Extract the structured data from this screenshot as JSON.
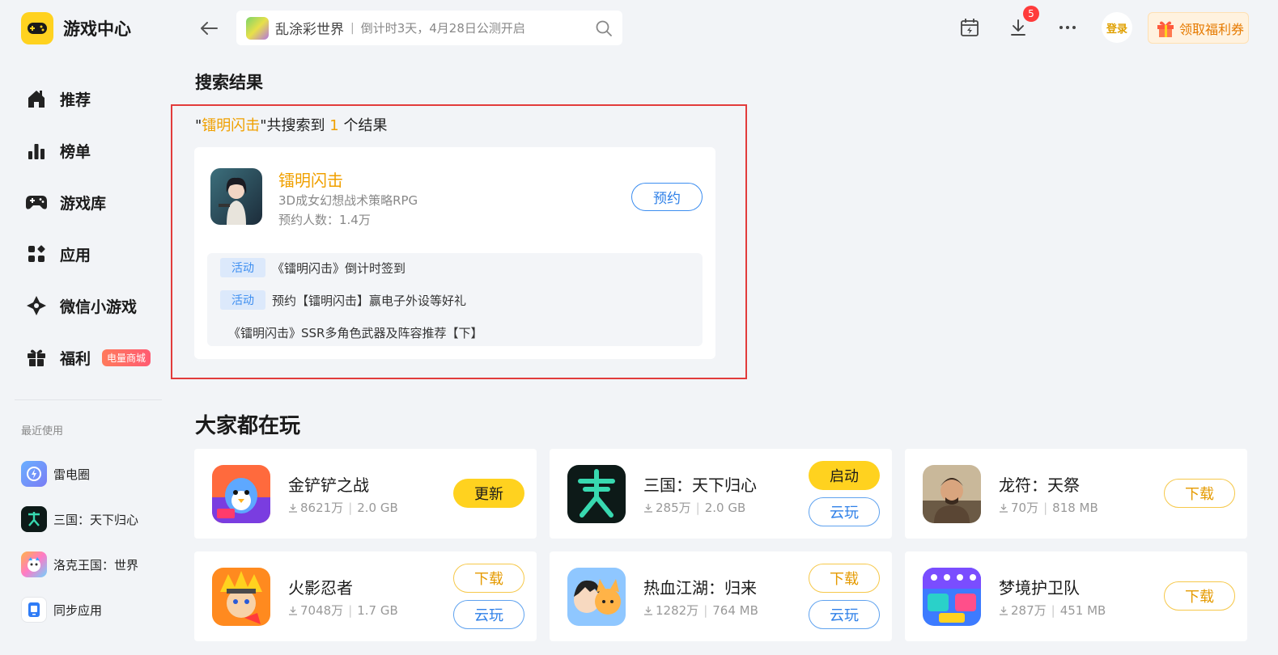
{
  "app": {
    "title": "游戏中心"
  },
  "sidebar": {
    "items": [
      {
        "label": "推荐",
        "icon": "home-icon"
      },
      {
        "label": "榜单",
        "icon": "ranking-icon"
      },
      {
        "label": "游戏库",
        "icon": "gamepad-icon"
      },
      {
        "label": "应用",
        "icon": "apps-icon"
      },
      {
        "label": "微信小游戏",
        "icon": "wechat-game-icon"
      },
      {
        "label": "福利",
        "icon": "gift-icon",
        "badge": "电量商城"
      }
    ],
    "recent_title": "最近使用",
    "recent": [
      {
        "label": "雷电圈"
      },
      {
        "label": "三国：天下归心"
      },
      {
        "label": "洛克王国：世界"
      },
      {
        "label": "同步应用"
      }
    ]
  },
  "header": {
    "search_game": "乱涂彩世界",
    "search_separator": "|",
    "search_hint": "倒计时3天，4月28日公测开启",
    "download_badge": "5",
    "login_label": "登录",
    "coupon_label": "领取福利券"
  },
  "results": {
    "title": "搜索结果",
    "summary": {
      "quote_open": "\"",
      "keyword": "镭明闪击",
      "middle": "\"共搜索到 ",
      "count": "1",
      "tail": " 个结果"
    },
    "card": {
      "name": "镭明闪击",
      "desc": "3D成女幻想战术策略RPG",
      "count": "预约人数：1.4万",
      "button": "预约",
      "activities": [
        {
          "tag": "活动",
          "text": "《镭明闪击》倒计时签到"
        },
        {
          "tag": "活动",
          "text": "预约【镭明闪击】赢电子外设等好礼"
        },
        {
          "tag": "",
          "text": "《镭明闪击》SSR多角色武器及阵容推荐【下】"
        }
      ]
    }
  },
  "popular": {
    "title": "大家都在玩",
    "games": [
      {
        "name": "金铲铲之战",
        "downloads": "8621万",
        "size": "2.0 GB",
        "buttons": [
          "更新"
        ]
      },
      {
        "name": "三国：天下归心",
        "downloads": "285万",
        "size": "2.0 GB",
        "buttons": [
          "启动",
          "云玩"
        ]
      },
      {
        "name": "龙符：天祭",
        "downloads": "70万",
        "size": "818 MB",
        "buttons": [
          "下载"
        ]
      },
      {
        "name": "火影忍者",
        "downloads": "7048万",
        "size": "1.7 GB",
        "buttons": [
          "下载",
          "云玩"
        ]
      },
      {
        "name": "热血江湖：归来",
        "downloads": "1282万",
        "size": "764 MB",
        "buttons": [
          "下载",
          "云玩"
        ]
      },
      {
        "name": "梦境护卫队",
        "downloads": "287万",
        "size": "451 MB",
        "buttons": [
          "下载"
        ]
      }
    ]
  },
  "colors": {
    "accent_yellow": "#ffd21f",
    "highlight_orange": "#f0a000",
    "link_blue": "#2f80e8",
    "badge_red": "#ff3b3b",
    "annotation_red": "#e23b3b"
  }
}
